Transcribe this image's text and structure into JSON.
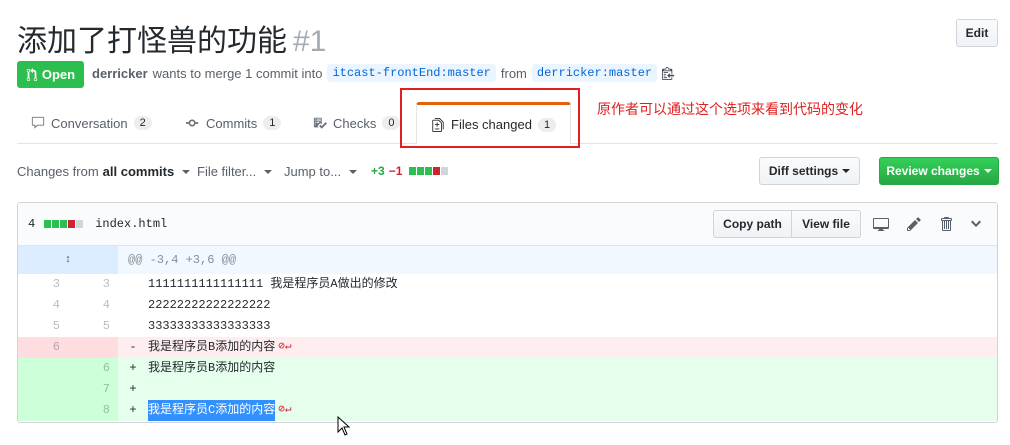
{
  "header": {
    "title": "添加了打怪兽的功能",
    "number": "#1",
    "edit_label": "Edit"
  },
  "state": {
    "label": "Open",
    "author": "derricker",
    "text": "wants to merge 1 commit into",
    "base_branch": "itcast-frontEnd:master",
    "from_text": "from",
    "head_branch": "derricker:master"
  },
  "tabs": [
    {
      "label": "Conversation",
      "count": "2"
    },
    {
      "label": "Commits",
      "count": "1"
    },
    {
      "label": "Checks",
      "count": "0"
    },
    {
      "label": "Files changed",
      "count": "1"
    }
  ],
  "annotation": "原作者可以通过这个选项来看到代码的变化",
  "toolbar": {
    "changes_from_prefix": "Changes from",
    "changes_from_value": "all commits",
    "file_filter": "File filter...",
    "jump_to": "Jump to...",
    "additions": "+3",
    "deletions": "−1",
    "diff_settings": "Diff settings",
    "review_changes": "Review changes"
  },
  "file": {
    "change_count": "4",
    "name": "index.html",
    "copy_path": "Copy path",
    "view_file": "View file",
    "hunk_header": "@@ -3,4 +3,6 @@",
    "lines": [
      {
        "old": "3",
        "new": "3",
        "marker": "",
        "text": "1111111111111111 我是程序员A做出的修改"
      },
      {
        "old": "4",
        "new": "4",
        "marker": "",
        "text": "22222222222222222"
      },
      {
        "old": "5",
        "new": "5",
        "marker": "",
        "text": "33333333333333333"
      },
      {
        "old": "6",
        "new": "",
        "marker": "-",
        "text": "我是程序员B添加的内容"
      },
      {
        "old": "",
        "new": "6",
        "marker": "+",
        "text": "我是程序员B添加的内容"
      },
      {
        "old": "",
        "new": "7",
        "marker": "+",
        "text": ""
      },
      {
        "old": "",
        "new": "8",
        "marker": "+",
        "text": "我是程序员C添加的内容"
      }
    ]
  },
  "colors": {
    "open_green": "#2cbe4e",
    "annotation_red": "#e02020",
    "link_blue": "#0366d6"
  }
}
